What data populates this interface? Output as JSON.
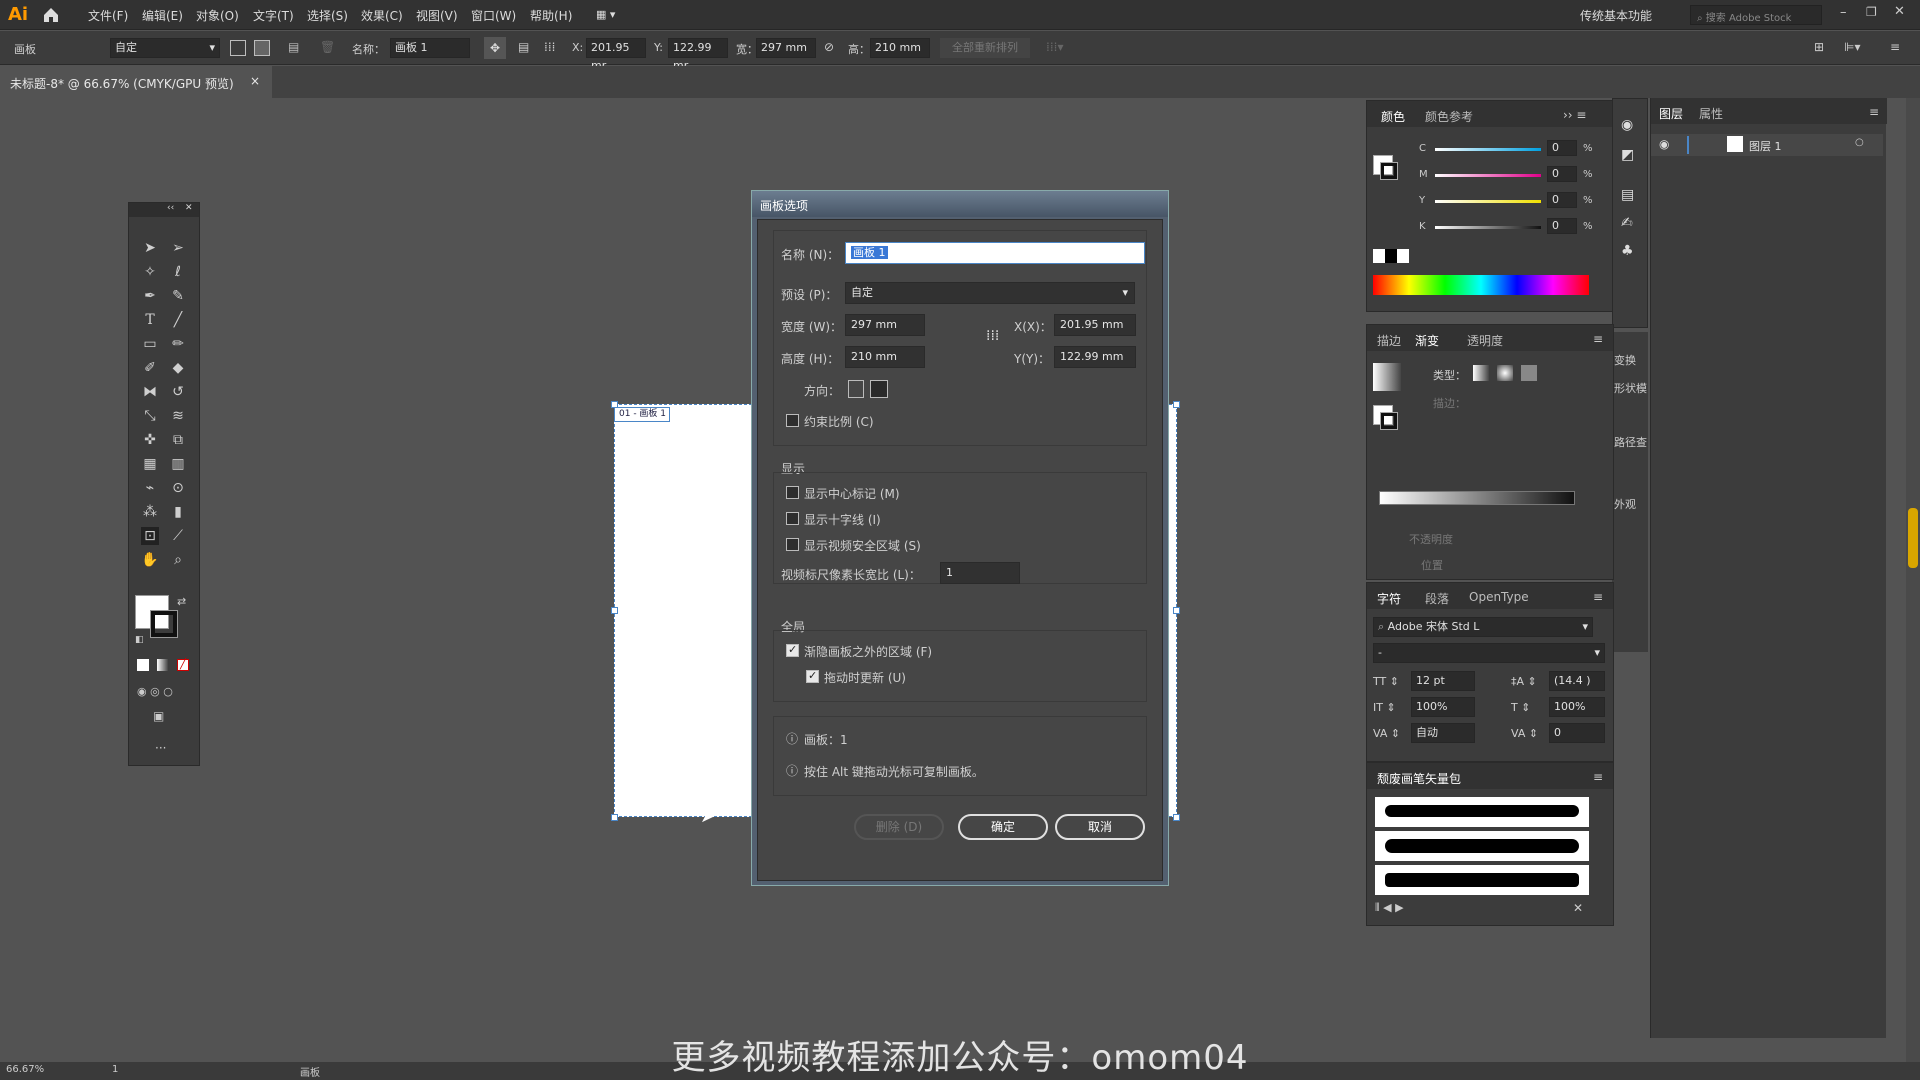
{
  "app": {
    "logo": "Ai",
    "workspace": "传统基本功能",
    "search_placeholder": "搜索 Adobe Stock"
  },
  "menu": [
    "文件(F)",
    "编辑(E)",
    "对象(O)",
    "文字(T)",
    "选择(S)",
    "效果(C)",
    "视图(V)",
    "窗口(W)",
    "帮助(H)"
  ],
  "control": {
    "tool_label": "画板",
    "preset": "自定",
    "name_label": "名称：",
    "name_value": "画板 1",
    "x_label": "X:",
    "x_value": "201.95 mr",
    "y_label": "Y:",
    "y_value": "122.99 mr",
    "w_label": "宽：",
    "w_value": "297 mm",
    "h_label": "高：",
    "h_value": "210 mm",
    "rearrange": "全部重新排列"
  },
  "doc_tab": {
    "title": "未标题-8* @ 66.67% (CMYK/GPU 预览)",
    "close": "×"
  },
  "artboard": {
    "label": "01 - 画板 1"
  },
  "dialog": {
    "title": "画板选项",
    "name_label": "名称 (N)：",
    "name_value": "画板 1",
    "preset_label": "预设 (P)：",
    "preset_value": "自定",
    "width_label": "宽度 (W)：",
    "width_value": "297 mm",
    "height_label": "高度 (H)：",
    "height_value": "210 mm",
    "x_label": "X(X)：",
    "x_value": "201.95 mm",
    "y_label": "Y(Y)：",
    "y_value": "122.99 mm",
    "orient_label": "方向：",
    "constrain": "约束比例 (C)",
    "display_title": "显示",
    "show_center": "显示中心标记 (M)",
    "show_cross": "显示十字线 (I)",
    "show_safe": "显示视频安全区域 (S)",
    "pixel_ratio_label": "视频标尺像素长宽比 (L)：",
    "pixel_ratio_value": "1",
    "global_title": "全局",
    "fade_outside": "渐隐画板之外的区域 (F)",
    "update_drag": "拖动时更新 (U)",
    "info_count": "画板：1",
    "info_tip": "按住 Alt 键拖动光标可复制画板。",
    "delete": "删除 (D)",
    "ok": "确定",
    "cancel": "取消"
  },
  "color_panel": {
    "tabs": [
      "颜色",
      "颜色参考"
    ],
    "channels": [
      {
        "name": "C",
        "value": "0",
        "color": "#00a0e0"
      },
      {
        "name": "M",
        "value": "0",
        "color": "#e0008a"
      },
      {
        "name": "Y",
        "value": "0",
        "color": "#f0e000"
      },
      {
        "name": "K",
        "value": "0",
        "color": "#bbbbbb"
      }
    ],
    "pct": "%"
  },
  "gradient_panel": {
    "tabs": [
      "描边",
      "渐变",
      "透明度"
    ],
    "type_label": "类型：",
    "stroke_label": "描边：",
    "opacity_label": "不透明度",
    "location_label": "位置"
  },
  "char_panel": {
    "tabs": [
      "字符",
      "段落",
      "OpenType"
    ],
    "font": "Adobe 宋体 Std L",
    "style": "-",
    "size": "12 pt",
    "leading": "(14.4 )",
    "vscale": "100%",
    "hscale": "100%",
    "kerning": "自动",
    "tracking": "0"
  },
  "brush_panel": {
    "title": "颓废画笔矢量包"
  },
  "side_labels": [
    "变换",
    "形状模",
    "路径查",
    "外观"
  ],
  "layers": {
    "tabs": [
      "图层",
      "属性"
    ],
    "layer_name": "图层 1"
  },
  "status": {
    "zoom": "66.67%",
    "page": "1",
    "tool": "画板"
  },
  "watermark": "更多视频教程添加公众号：omom04"
}
